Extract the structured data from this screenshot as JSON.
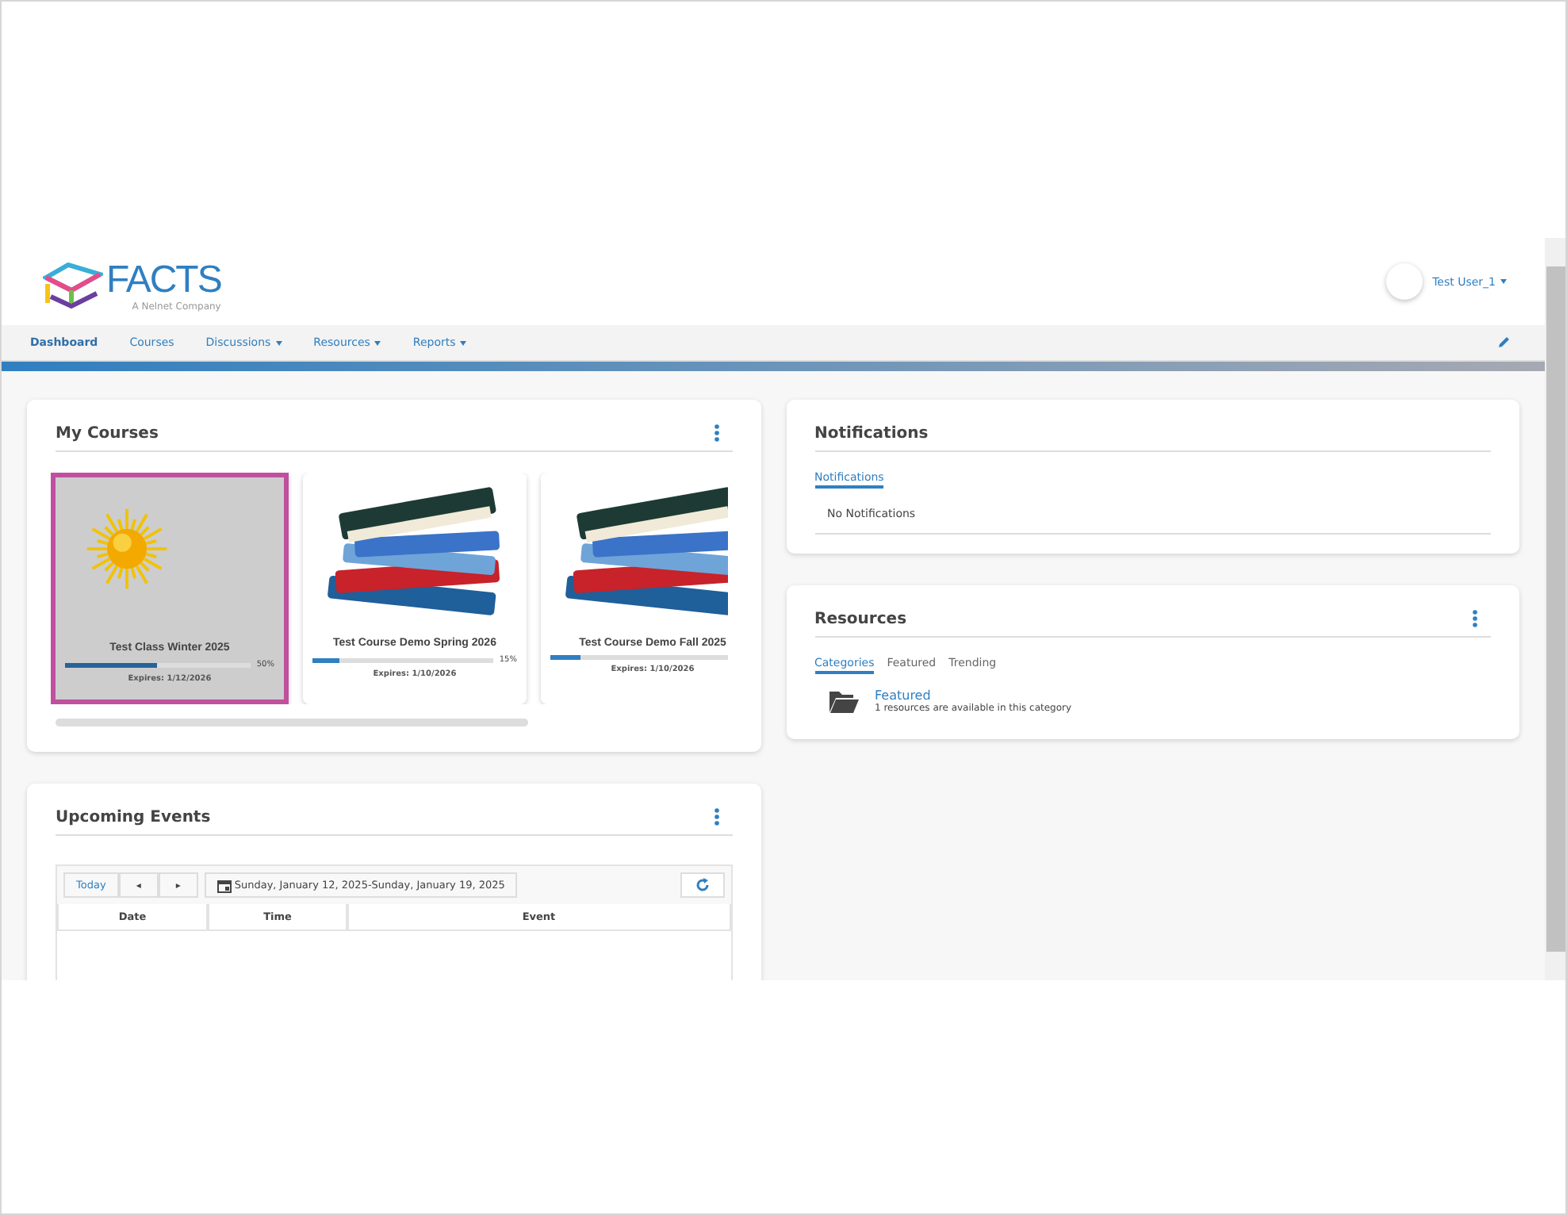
{
  "header": {
    "logo": {
      "wordmark": "FACTS",
      "tagline": "A Nelnet Company"
    },
    "user": {
      "name": "Test User_1"
    }
  },
  "nav": [
    {
      "label": "Dashboard",
      "selected": true,
      "dropdown": false
    },
    {
      "label": "Courses",
      "selected": false,
      "dropdown": false
    },
    {
      "label": "Discussions",
      "selected": false,
      "dropdown": true
    },
    {
      "label": "Resources",
      "selected": false,
      "dropdown": true
    },
    {
      "label": "Reports",
      "selected": false,
      "dropdown": true
    }
  ],
  "my_courses": {
    "title": "My Courses",
    "courses": [
      {
        "title": "Test Class Winter 2025",
        "kind": "sun",
        "level": 0.5,
        "percent": "50%",
        "expires": "Expires: 1/12/2026",
        "selected": true
      },
      {
        "title": "Test Course Demo Spring 2026",
        "kind": "books",
        "level": 0.15,
        "percent": "15%",
        "expires": "Expires: 1/10/2026",
        "selected": false
      },
      {
        "title": "Test Course Demo Fall 2025",
        "kind": "books",
        "level": 0.15,
        "expires": "Expires: 1/10/2026",
        "selected": false
      }
    ]
  },
  "notifications": {
    "title": "Notifications",
    "tabs": [
      {
        "label": "Notifications",
        "selected": true
      }
    ],
    "empty_text": "No Notifications"
  },
  "resources": {
    "title": "Resources",
    "tabs": [
      {
        "label": "Categories",
        "selected": true
      },
      {
        "label": "Featured",
        "selected": false
      },
      {
        "label": "Trending",
        "selected": false
      }
    ],
    "categories": [
      {
        "name": "Featured",
        "description": "1 resources are available in this category"
      }
    ]
  },
  "upcoming_events": {
    "title": "Upcoming Events",
    "today_button": "Today",
    "prev_button": "◂",
    "next_button": "▸",
    "date_range": "Sunday, January 12, 2025-Sunday, January 19, 2025",
    "columns": [
      "Date",
      "Time",
      "Event"
    ]
  }
}
